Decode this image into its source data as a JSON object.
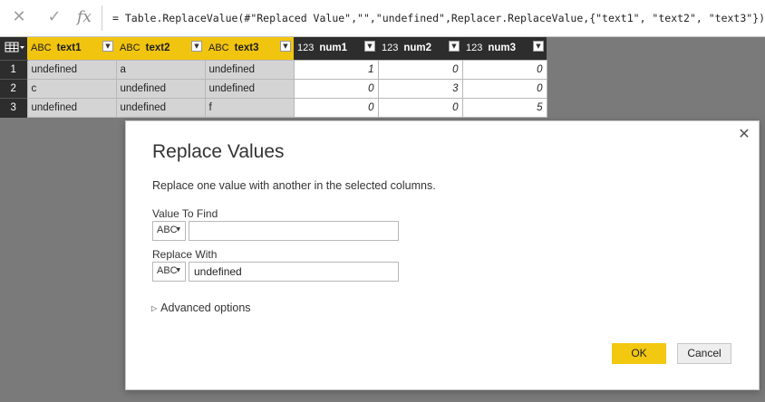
{
  "formula_bar": {
    "cancel_icon": "close-icon",
    "commit_icon": "check-icon",
    "fx_label": "fx",
    "formula": "= Table.ReplaceValue(#\"Replaced Value\",\"\",\"undefined\",Replacer.ReplaceValue,{\"text1\", \"text2\", \"text3\"})"
  },
  "table": {
    "columns": [
      {
        "name": "text1",
        "type_label": "ABC",
        "kind": "text"
      },
      {
        "name": "text2",
        "type_label": "ABC",
        "kind": "text"
      },
      {
        "name": "text3",
        "type_label": "ABC",
        "kind": "text"
      },
      {
        "name": "num1",
        "type_label": "123",
        "kind": "number"
      },
      {
        "name": "num2",
        "type_label": "123",
        "kind": "number"
      },
      {
        "name": "num3",
        "type_label": "123",
        "kind": "number"
      }
    ],
    "rows": [
      {
        "index": "1",
        "cells": [
          "undefined",
          "a",
          "undefined",
          "1",
          "0",
          "0"
        ]
      },
      {
        "index": "2",
        "cells": [
          "c",
          "undefined",
          "undefined",
          "0",
          "3",
          "0"
        ]
      },
      {
        "index": "3",
        "cells": [
          "undefined",
          "undefined",
          "f",
          "0",
          "0",
          "5"
        ]
      }
    ]
  },
  "dialog": {
    "title": "Replace Values",
    "description": "Replace one value with another in the selected columns.",
    "find_label": "Value To Find",
    "find_value": "",
    "replace_label": "Replace With",
    "replace_value": "undefined",
    "type_button_label": "ABC",
    "advanced_label": "Advanced options",
    "ok_label": "OK",
    "cancel_label": "Cancel",
    "accent_color": "#f2c811"
  }
}
